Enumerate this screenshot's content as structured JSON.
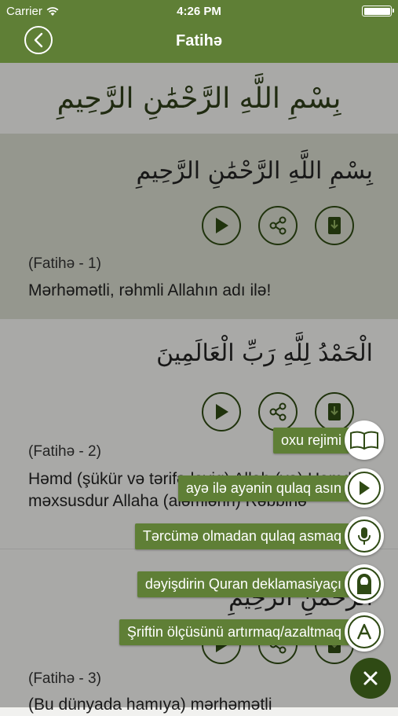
{
  "status_bar": {
    "carrier": "Carrier",
    "time": "4:26 PM"
  },
  "nav": {
    "title": "Fatihə"
  },
  "banner": {
    "arabic": "بِسْمِ اللَّهِ الرَّحْمَٰنِ الرَّحِيمِ"
  },
  "verses": [
    {
      "arabic": "بِسْمِ اللَّهِ الرَّحْمَٰنِ الرَّحِيمِ",
      "ref": "(Fatihə - 1)",
      "translation": "Mərhəmətli, rəhmli Allahın adı ilə!"
    },
    {
      "arabic": "الْحَمْدُ لِلَّهِ رَبِّ الْعَالَمِينَ",
      "ref": "(Fatihə - 2)",
      "translation": "Həmd (şükür və tərifə layiq) Allah (ya) Həmd məxsusdur Allaha (aləmlərin) Rəbbinə"
    },
    {
      "arabic": "الرَّحْمَٰنِ الرَّحِيمِ",
      "ref": "(Fatihə - 3)",
      "translation": "(Bu dünyada hamıya) mərhəmətli"
    }
  ],
  "menu": {
    "items": [
      {
        "label": "oxu rejimi",
        "icon": "book-icon"
      },
      {
        "label": "ayə ilə ayənin qulaq asın",
        "icon": "play-icon"
      },
      {
        "label": "Tərcümə olmadan qulaq asmaq",
        "icon": "microphone-icon"
      },
      {
        "label": "dəyişdirin Quran deklamasiyaçı",
        "icon": "reciter-icon"
      },
      {
        "label": "Şriftin ölçüsünü artırmaq/azaltmaq",
        "icon": "font-size-icon"
      }
    ],
    "close_icon": "close-icon"
  },
  "colors": {
    "primary": "#5f7f36",
    "dark": "#2f4a14"
  }
}
